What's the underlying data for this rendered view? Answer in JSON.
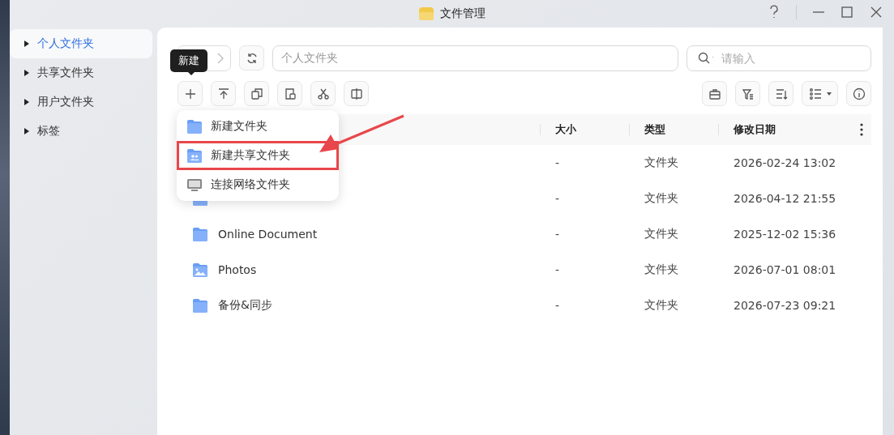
{
  "window": {
    "title": "文件管理"
  },
  "sidebar": {
    "items": [
      {
        "label": "个人文件夹",
        "selected": true,
        "expanded": false
      },
      {
        "label": "共享文件夹",
        "selected": false,
        "expanded": false
      },
      {
        "label": "用户文件夹",
        "selected": false,
        "expanded": false
      },
      {
        "label": "标签",
        "selected": false,
        "expanded": false
      }
    ]
  },
  "path_field": {
    "value": "个人文件夹"
  },
  "search": {
    "placeholder": "请输入"
  },
  "tooltip": "新建",
  "new_menu": {
    "items": [
      {
        "label": "新建文件夹",
        "kind": "folder",
        "highlighted": false
      },
      {
        "label": "新建共享文件夹",
        "kind": "shared",
        "highlighted": true
      },
      {
        "label": "连接网络文件夹",
        "kind": "network",
        "highlighted": false
      }
    ]
  },
  "table": {
    "columns": [
      "大小",
      "类型",
      "修改日期"
    ],
    "rows": [
      {
        "size": "-",
        "type": "文件夹",
        "modified": "2026-02-24 13:02"
      },
      {
        "kind": "folder",
        "size": "-",
        "type": "文件夹",
        "modified": "2026-04-12 21:55"
      },
      {
        "name": "Online Document",
        "kind": "folder",
        "size": "-",
        "type": "文件夹",
        "modified": "2025-12-02 15:36"
      },
      {
        "name": "Photos",
        "kind": "photos",
        "size": "-",
        "type": "文件夹",
        "modified": "2026-07-01 08:01"
      },
      {
        "name": "备份&同步",
        "kind": "folder",
        "size": "-",
        "type": "文件夹",
        "modified": "2026-07-23 09:21"
      }
    ]
  }
}
